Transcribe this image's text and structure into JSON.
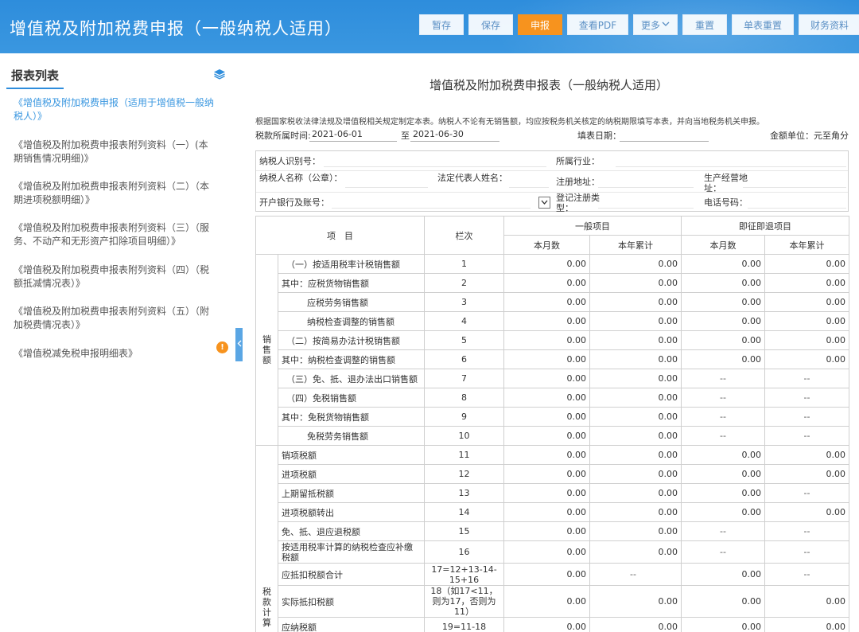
{
  "header": {
    "title": "增值税及附加税费申报（一般纳税人适用）",
    "buttons": [
      {
        "label": "暂存",
        "primary": false,
        "dropdown": false
      },
      {
        "label": "保存",
        "primary": false,
        "dropdown": false
      },
      {
        "label": "申报",
        "primary": true,
        "dropdown": false
      },
      {
        "label": "查看PDF",
        "primary": false,
        "dropdown": false
      },
      {
        "label": "更多",
        "primary": false,
        "dropdown": true
      },
      {
        "label": "重置",
        "primary": false,
        "dropdown": false
      },
      {
        "label": "单表重置",
        "primary": false,
        "dropdown": false
      },
      {
        "label": "财务资料",
        "primary": false,
        "dropdown": false
      }
    ]
  },
  "sidebar": {
    "title": "报表列表",
    "items": [
      {
        "label": "《增值税及附加税费申报（适用于增值税一般纳税人）》",
        "active": true
      },
      {
        "label": "《增值税及附加税费申报表附列资料（一）(本期销售情况明细)》",
        "active": false
      },
      {
        "label": "《增值税及附加税费申报表附列资料（二）（本期进项税额明细）》",
        "active": false
      },
      {
        "label": "《增值税及附加税费申报表附列资料（三）（服务、不动产和无形资产扣除项目明细）》",
        "active": false
      },
      {
        "label": "《增值税及附加税费申报表附列资料（四）（税额抵减情况表）》",
        "active": false
      },
      {
        "label": "《增值税及附加税费申报表附列资料（五）（附加税费情况表）》",
        "active": false
      },
      {
        "label": "《增值税减免税申报明细表》",
        "active": false
      }
    ],
    "warn_badge": "!"
  },
  "form": {
    "title": "增值税及附加税费申报表（一般纳税人适用）",
    "intro": "根据国家税收法律法规及增值税相关规定制定本表。纳税人不论有无销售额，均应按税务机关核定的纳税期限填写本表，并向当地税务机关申报。",
    "period_label": "税款所属时间:",
    "period_start": "2021-06-01",
    "period_sep": "至",
    "period_end": "2021-06-30",
    "fill_date_label": "填表日期：",
    "unit": "金额单位：元至角分",
    "info": {
      "taxpayer_id": "纳税人识别号：",
      "industry": "所属行业：",
      "taxpayer_name": "纳税人名称（公章）：",
      "legal_rep": "法定代表人姓名：",
      "reg_address": "注册地址：",
      "biz_address": "生产经营地址：",
      "bank_account": "开户银行及账号：",
      "reg_type": "登记注册类型：",
      "phone": "电话号码："
    }
  },
  "table": {
    "headers": {
      "item": "项　目",
      "col": "栏次",
      "general": "一般项目",
      "immediate": "即征即退项目",
      "month": "本月数",
      "year": "本年累计"
    },
    "categories": {
      "sales": "销售额",
      "tax": "税款计算"
    },
    "rows": [
      {
        "item": "（一）按适用税率计税销售额",
        "col": "1",
        "vals": [
          "0.00",
          "0.00",
          "0.00",
          "0.00"
        ]
      },
      {
        "item": "其中：应税货物销售额",
        "col": "2",
        "vals": [
          "0.00",
          "0.00",
          "0.00",
          "0.00"
        ]
      },
      {
        "item": "应税劳务销售额",
        "col": "3",
        "vals": [
          "0.00",
          "0.00",
          "0.00",
          "0.00"
        ]
      },
      {
        "item": "纳税检查调整的销售额",
        "col": "4",
        "vals": [
          "0.00",
          "0.00",
          "0.00",
          "0.00"
        ]
      },
      {
        "item": "（二）按简易办法计税销售额",
        "col": "5",
        "vals": [
          "0.00",
          "0.00",
          "0.00",
          "0.00"
        ]
      },
      {
        "item": "其中：纳税检查调整的销售额",
        "col": "6",
        "vals": [
          "0.00",
          "0.00",
          "0.00",
          "0.00"
        ]
      },
      {
        "item": "（三）免、抵、退办法出口销售额",
        "col": "7",
        "vals": [
          "0.00",
          "0.00",
          "--",
          "--"
        ]
      },
      {
        "item": "（四）免税销售额",
        "col": "8",
        "vals": [
          "0.00",
          "0.00",
          "--",
          "--"
        ]
      },
      {
        "item": "其中：免税货物销售额",
        "col": "9",
        "vals": [
          "0.00",
          "0.00",
          "--",
          "--"
        ]
      },
      {
        "item": "免税劳务销售额",
        "col": "10",
        "vals": [
          "0.00",
          "0.00",
          "--",
          "--"
        ]
      },
      {
        "item": "销项税额",
        "col": "11",
        "vals": [
          "0.00",
          "0.00",
          "0.00",
          "0.00"
        ]
      },
      {
        "item": "进项税额",
        "col": "12",
        "vals": [
          "0.00",
          "0.00",
          "0.00",
          "0.00"
        ]
      },
      {
        "item": "上期留抵税额",
        "col": "13",
        "vals": [
          "0.00",
          "0.00",
          "0.00",
          "--"
        ]
      },
      {
        "item": "进项税额转出",
        "col": "14",
        "vals": [
          "0.00",
          "0.00",
          "0.00",
          "0.00"
        ]
      },
      {
        "item": "免、抵、退应退税额",
        "col": "15",
        "vals": [
          "0.00",
          "0.00",
          "--",
          "--"
        ]
      },
      {
        "item": "按适用税率计算的纳税检查应补缴税额",
        "col": "16",
        "vals": [
          "0.00",
          "0.00",
          "--",
          "--"
        ]
      },
      {
        "item": "应抵扣税额合计",
        "col": "17=12+13-14-15+16",
        "vals": [
          "0.00",
          "--",
          "0.00",
          "--"
        ]
      },
      {
        "item": "实际抵扣税额",
        "col": "18（如17<11，则为17，否则为11）",
        "vals": [
          "0.00",
          "0.00",
          "0.00",
          "0.00"
        ]
      },
      {
        "item": "应纳税额",
        "col": "19=11-18",
        "vals": [
          "0.00",
          "0.00",
          "0.00",
          "0.00"
        ]
      }
    ]
  },
  "colors": {
    "header_bg": "#2e8ddc",
    "primary_button": "#f7931e",
    "link_blue": "#3a97e0"
  }
}
